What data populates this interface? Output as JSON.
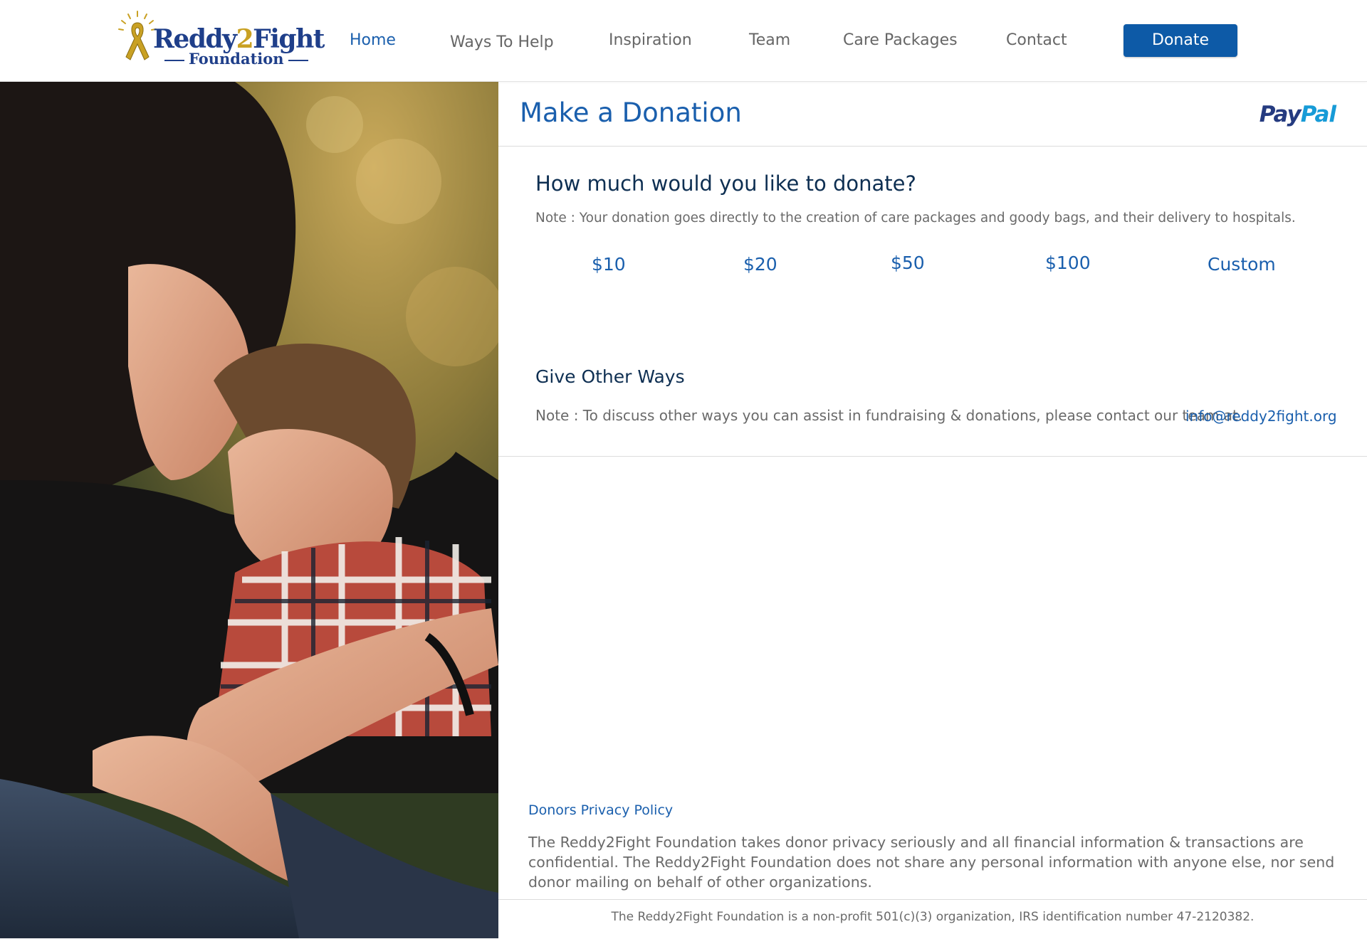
{
  "header": {
    "logo": {
      "word_a": "Reddy",
      "word_two": "2",
      "word_b": "Fight",
      "sub": "Foundation"
    },
    "nav": [
      {
        "label": "Home",
        "active": true
      },
      {
        "label": "Ways To Help"
      },
      {
        "label": "Inspiration"
      },
      {
        "label": "Team"
      },
      {
        "label": "Care Packages"
      },
      {
        "label": "Contact"
      }
    ],
    "donate_label": "Donate"
  },
  "hero": {
    "image": "mother-hugging-child-photo"
  },
  "donation": {
    "title": "Make a Donation",
    "paypal": {
      "pay": "Pay",
      "pal": "Pal"
    },
    "question": "How much would you like to donate?",
    "note": "Note : Your donation goes directly to the creation of care packages and goody bags, and their delivery to hospitals.",
    "amounts": [
      "$10",
      "$20",
      "$50",
      "$100",
      "Custom"
    ]
  },
  "other_ways": {
    "title": "Give Other Ways",
    "note": "Note : To discuss other ways you can assist in fundraising & donations, please contact our team at.",
    "email": "info@reddy2fight.org"
  },
  "privacy": {
    "title": "Donors Privacy Policy",
    "text": "The Reddy2Fight Foundation takes donor privacy seriously and all financial information & transactions are confidential. The Reddy2Fight Foundation does not share any personal information with anyone else, nor send donor mailing on behalf of other organizations."
  },
  "footer": {
    "text": "The Reddy2Fight Foundation is a non-profit 501(c)(3) organization, IRS identification number 47-2120382."
  },
  "colors": {
    "accent": "#1a5fad",
    "button": "#0d5aa7",
    "heading": "#0e2f52",
    "ribbon_gold": "#c9a124",
    "brand_navy": "#1f3f8a"
  }
}
